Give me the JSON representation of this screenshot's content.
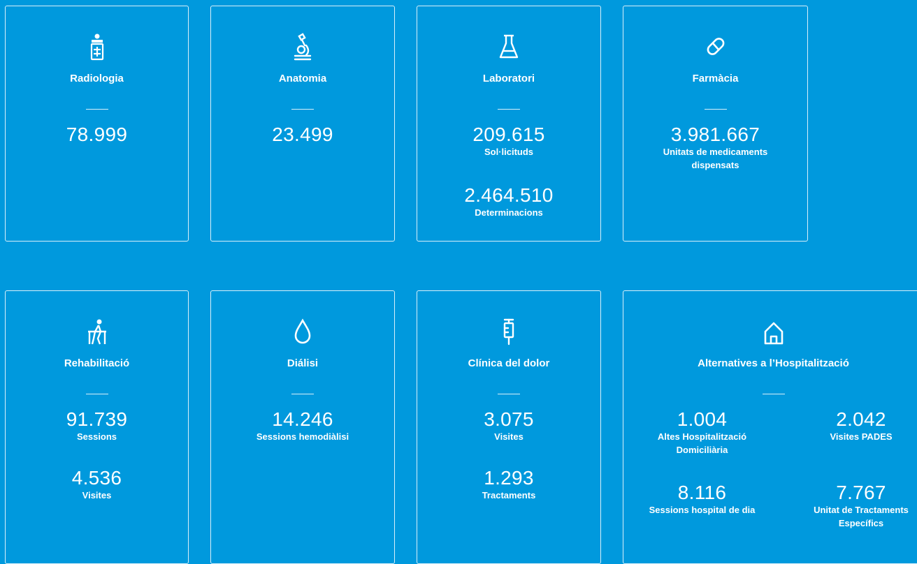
{
  "colors": {
    "background": "#0099dd",
    "foreground": "#ffffff"
  },
  "cards": [
    {
      "title": "Radiologia",
      "icon": "radiology-patient-icon",
      "metrics": [
        {
          "value": "78.999",
          "label": ""
        }
      ]
    },
    {
      "title": "Anatomia",
      "icon": "microscope-icon",
      "metrics": [
        {
          "value": "23.499",
          "label": ""
        }
      ]
    },
    {
      "title": "Laboratori",
      "icon": "flask-icon",
      "metrics": [
        {
          "value": "209.615",
          "label": "Sol·licituds"
        },
        {
          "value": "2.464.510",
          "label": "Determinacions"
        }
      ]
    },
    {
      "title": "Farmàcia",
      "icon": "pill-icon",
      "metrics": [
        {
          "value": "3.981.667",
          "label": "Unitats de medicaments dispensats"
        }
      ]
    },
    {
      "title": "Rehabilitació",
      "icon": "rehabilitation-icon",
      "metrics": [
        {
          "value": "91.739",
          "label": "Sessions"
        },
        {
          "value": "4.536",
          "label": "Visites"
        }
      ]
    },
    {
      "title": "Diálisi",
      "icon": "drop-icon",
      "metrics": [
        {
          "value": "14.246",
          "label": "Sessions hemodiàlisi"
        }
      ]
    },
    {
      "title": "Clínica del dolor",
      "icon": "syringe-icon",
      "metrics": [
        {
          "value": "3.075",
          "label": "Visites"
        },
        {
          "value": "1.293",
          "label": "Tractaments"
        }
      ]
    },
    {
      "title": "Alternatives a l’Hospitalització",
      "icon": "home-icon",
      "metrics": [
        {
          "value": "1.004",
          "label": "Altes Hospitalització Domiciliària"
        },
        {
          "value": "2.042",
          "label": "Visites PADES"
        },
        {
          "value": "8.116",
          "label": "Sessions hospital de dia"
        },
        {
          "value": "7.767",
          "label": "Unitat de Tractaments Específics"
        }
      ]
    }
  ]
}
